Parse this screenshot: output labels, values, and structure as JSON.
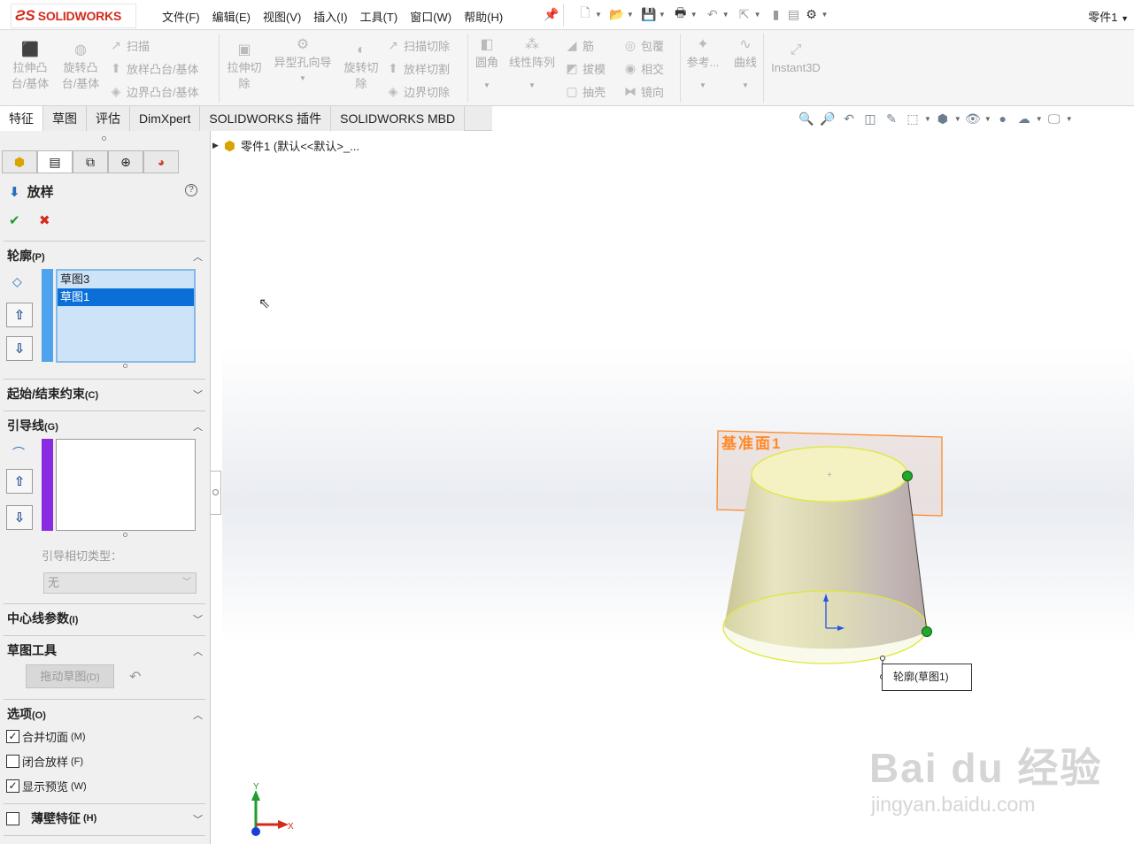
{
  "app": {
    "logo": "SOLIDWORKS",
    "document_title": "零件1",
    "menu": [
      "文件(F)",
      "编辑(E)",
      "视图(V)",
      "插入(I)",
      "工具(T)",
      "窗口(W)",
      "帮助(H)"
    ]
  },
  "quick_access_icons": [
    "new-icon",
    "open-icon",
    "save-icon",
    "print-icon",
    "undo-icon",
    "select-icon",
    "rebuild-icon",
    "file-properties-icon",
    "options-icon"
  ],
  "ribbon": {
    "extrude_boss": "拉伸凸\n台/基体",
    "revolve_boss": "旋转凸\n台/基体",
    "sweep": "扫描",
    "loft_boss": "放样凸台/基体",
    "boundary_boss": "边界凸台/基体",
    "extrude_cut": "拉伸切\n除",
    "hole_wizard": "异型孔向导",
    "revolve_cut": "旋转切\n除",
    "swept_cut": "扫描切除",
    "lofted_cut": "放样切割",
    "boundary_cut": "边界切除",
    "fillet": "圆角",
    "linear_pattern": "线性阵列",
    "rib": "筋",
    "draft": "拔模",
    "shell": "抽壳",
    "wrap": "包覆",
    "intersect": "相交",
    "mirror": "镜向",
    "reference": "参考...",
    "curves": "曲线",
    "instant3d": "Instant3D"
  },
  "tabs": [
    "特征",
    "草图",
    "评估",
    "DimXpert",
    "SOLIDWORKS 插件",
    "SOLIDWORKS MBD"
  ],
  "property_manager": {
    "title": "放样",
    "profiles_label": "轮廓",
    "profiles_key": "(P)",
    "profiles": [
      "草图3",
      "草图1"
    ],
    "selected_profile": "草图1",
    "start_end_label": "起始/结束约束",
    "start_end_key": "(C)",
    "guides_label": "引导线",
    "guides_key": "(G)",
    "guide_tangency_label": "引导相切类型：",
    "guide_tangency_value": "无",
    "centerline_label": "中心线参数",
    "centerline_key": "(I)",
    "sketch_tools_label": "草图工具",
    "drag_sketch_label": "拖动草图",
    "drag_sketch_key": "(D)",
    "options_label": "选项",
    "options_key": "(O)",
    "merge_faces_label": "合并切面",
    "merge_faces_key": "(M)",
    "merge_faces_checked": true,
    "close_loft_label": "闭合放样",
    "close_loft_key": "(F)",
    "close_loft_checked": false,
    "show_preview_label": "显示预览",
    "show_preview_key": "(W)",
    "show_preview_checked": true,
    "thin_feature_label": "薄壁特征",
    "thin_feature_key": "(H)",
    "thin_feature_checked": false
  },
  "feature_tree": {
    "root": "零件1  (默认<<默认>_..."
  },
  "viewport": {
    "plane_label": "基准面1",
    "callout": "轮廓(草图1)",
    "triad_x": "X",
    "triad_y": "Y",
    "watermark": "Bai du 经验",
    "watermark_sub": "jingyan.baidu.com"
  },
  "colors": {
    "brand": "#d42a1c",
    "selection": "#0a6fd6",
    "profile_bar": "#4ea3ef",
    "guide_bar": "#8a2be2",
    "plane": "#ff8a2a",
    "handle": "#1faa2c"
  }
}
